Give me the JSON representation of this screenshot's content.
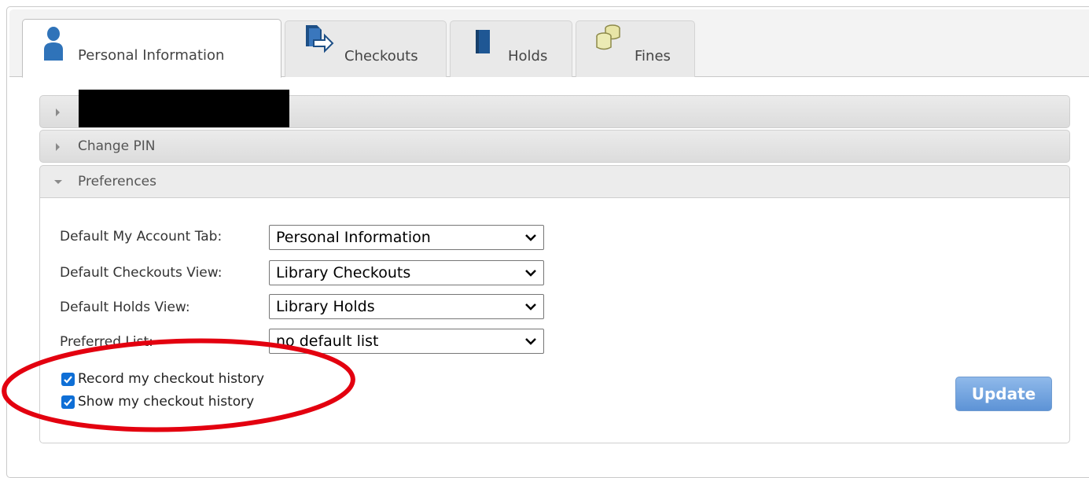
{
  "tabs": [
    {
      "label": "Personal Information",
      "icon": "person-icon",
      "active": true
    },
    {
      "label": "Checkouts",
      "icon": "checkout-book-icon",
      "active": false
    },
    {
      "label": "Holds",
      "icon": "book-icon",
      "active": false
    },
    {
      "label": "Fines",
      "icon": "coins-icon",
      "active": false
    }
  ],
  "sections": [
    {
      "title": "",
      "expanded": false,
      "redacted": true
    },
    {
      "title": "Change PIN",
      "expanded": false
    },
    {
      "title": "Preferences",
      "expanded": true
    }
  ],
  "preferences": {
    "fields": [
      {
        "label": "Default My Account Tab:",
        "value": "Personal Information"
      },
      {
        "label": "Default Checkouts View:",
        "value": "Library Checkouts"
      },
      {
        "label": "Default Holds View:",
        "value": "Library Holds"
      },
      {
        "label": "Preferred List:",
        "value": "no default list"
      }
    ],
    "checkboxes": [
      {
        "label": "Record my checkout history",
        "checked": true
      },
      {
        "label": "Show my checkout history",
        "checked": true
      }
    ],
    "update_label": "Update"
  },
  "colors": {
    "accent": "#0f6fd6",
    "button": "#6d9fdc",
    "annotation": "#e3000f"
  }
}
